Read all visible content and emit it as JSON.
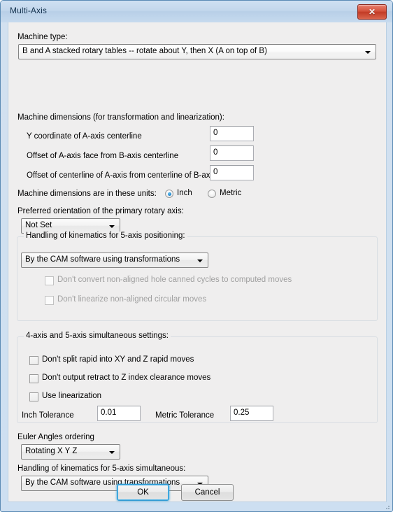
{
  "window": {
    "title": "Multi-Axis",
    "close_label": "✕"
  },
  "machine_type": {
    "label": "Machine type:",
    "value": "B and A stacked rotary tables -- rotate about Y, then X (A on top of B)"
  },
  "dimensions": {
    "heading": "Machine dimensions (for transformation and linearization):",
    "rows": [
      {
        "label": "Y coordinate of A-axis centerline",
        "value": "0"
      },
      {
        "label": "Offset of A-axis face from B-axis centerline",
        "value": "0"
      },
      {
        "label": "Offset of centerline of A-axis from centerline of B-axis",
        "value": "0"
      }
    ],
    "units_label": "Machine dimensions are in these units:",
    "units_options": [
      {
        "label": "Inch",
        "selected": true
      },
      {
        "label": "Metric",
        "selected": false
      }
    ]
  },
  "orientation": {
    "label": "Preferred orientation of the primary rotary axis:",
    "value": "Not Set"
  },
  "kinematics_positioning": {
    "group_title": "Handling of kinematics for 5-axis positioning:",
    "value": "By the CAM software using transformations",
    "checkboxes": [
      {
        "label": "Don't convert non-aligned hole canned cycles to computed moves",
        "checked": false,
        "enabled": false
      },
      {
        "label": "Don't linearize non-aligned circular moves",
        "checked": false,
        "enabled": false
      }
    ]
  },
  "simultaneous": {
    "group_title": "4-axis and 5-axis simultaneous settings:",
    "checkboxes": [
      {
        "label": "Don't split rapid into XY and Z rapid moves",
        "checked": false
      },
      {
        "label": "Don't output retract to Z index clearance moves",
        "checked": false
      },
      {
        "label": "Use linearization",
        "checked": false
      }
    ],
    "inch_tolerance_label": "Inch Tolerance",
    "inch_tolerance_value": "0.01",
    "metric_tolerance_label": "Metric Tolerance",
    "metric_tolerance_value": "0.25"
  },
  "euler": {
    "label": "Euler Angles ordering",
    "value": "Rotating X Y Z"
  },
  "kinematics_simultaneous": {
    "label": "Handling of kinematics for 5-axis simultaneous:",
    "value": "By the CAM software using transformations"
  },
  "footer": {
    "ok_label": "OK",
    "cancel_label": "Cancel"
  },
  "colors": {
    "accent": "#2f9bd4",
    "close_button": "#c23b26",
    "dialog_frame": "#cddff1",
    "client_background": "#efeeee"
  }
}
